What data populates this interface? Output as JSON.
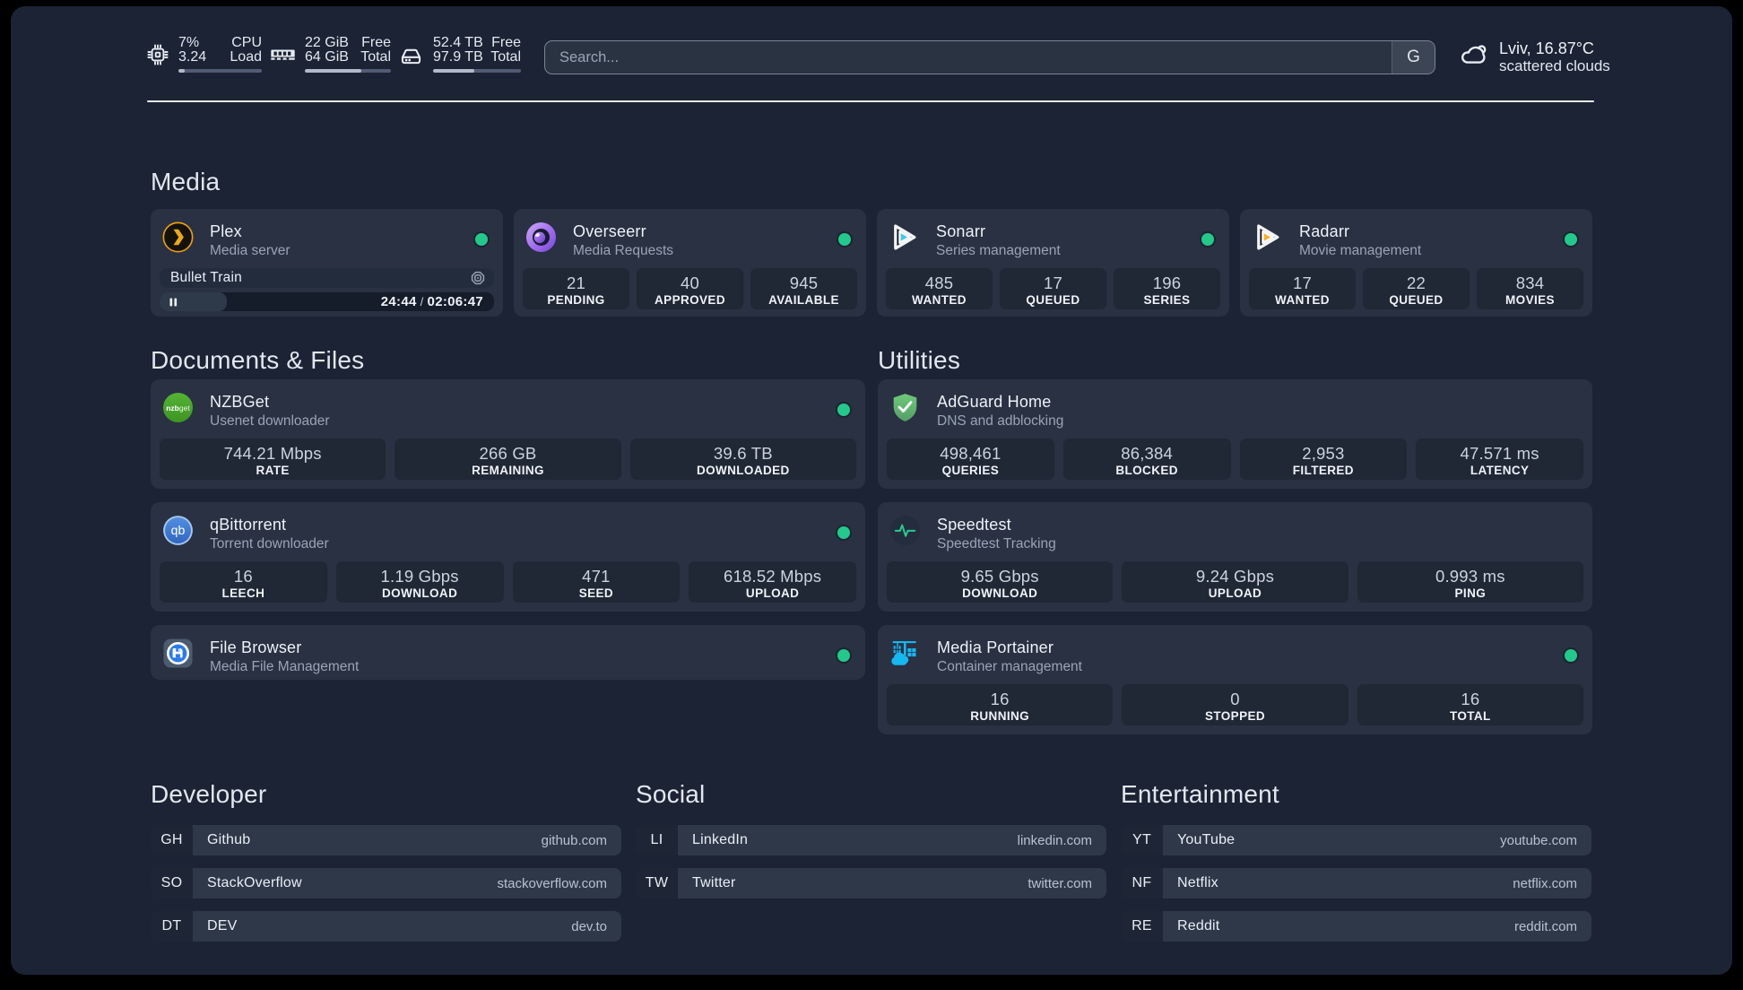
{
  "window": {
    "background": "#000000",
    "page_background": "#1b2334"
  },
  "theme": {
    "card": "#293142",
    "stat_box": "#202836",
    "status_online": "#22c98b",
    "divider": "#e8ebf0",
    "accent_plex": "#e5a00d",
    "accent_sonarr": "#38c6f4",
    "accent_radarr": "#fcb022",
    "accent_overseerr": "#9261e7",
    "accent_nzbget": "#4aa52e",
    "accent_qbittorrent": "#4a84d4",
    "accent_adguard": "#63b973",
    "accent_speedtest": "#27c98f",
    "accent_portainer": "#16b8f2",
    "accent_filebrowser": "#2b7cea"
  },
  "topbar": {
    "resources": [
      {
        "id": "cpu",
        "icon": "cpu-icon",
        "line1_left": "7%",
        "line1_right": "CPU",
        "line2_left": "3.24",
        "line2_right": "Load",
        "bar_width": "8%"
      },
      {
        "id": "memory",
        "icon": "memory-icon",
        "line1_left": "22 GiB",
        "line1_right": "Free",
        "line2_left": "64 GiB",
        "line2_right": "Total",
        "bar_width": "65.6%"
      },
      {
        "id": "disk",
        "icon": "disk-icon",
        "line1_left": "52.4 TB",
        "line1_right": "Free",
        "line2_left": "97.9 TB",
        "line2_right": "Total",
        "bar_width": "46.5%"
      }
    ],
    "search": {
      "placeholder": "Search...",
      "button_label": "G"
    },
    "weather": {
      "icon": "cloud-icon",
      "location_temp": "Lviv, 16.87°C",
      "condition": "scattered clouds"
    }
  },
  "groups": [
    {
      "title": "Media",
      "services": [
        {
          "id": "plex",
          "name": "Plex",
          "description": "Media server",
          "icon": "plex-icon",
          "status": "online",
          "now_playing": {
            "title": "Bullet Train",
            "icon": "camera-iris-icon",
            "elapsed": "24:44",
            "separator": "/",
            "total": "02:06:47",
            "progress_width": "20%"
          }
        },
        {
          "id": "overseerr",
          "name": "Overseerr",
          "description": "Media Requests",
          "icon": "overseerr-icon",
          "status": "online",
          "stats": [
            {
              "value": "21",
              "label": "PENDING"
            },
            {
              "value": "40",
              "label": "APPROVED"
            },
            {
              "value": "945",
              "label": "AVAILABLE"
            }
          ]
        },
        {
          "id": "sonarr",
          "name": "Sonarr",
          "description": "Series management",
          "icon": "sonarr-icon",
          "status": "online",
          "stats": [
            {
              "value": "485",
              "label": "WANTED"
            },
            {
              "value": "17",
              "label": "QUEUED"
            },
            {
              "value": "196",
              "label": "SERIES"
            }
          ]
        },
        {
          "id": "radarr",
          "name": "Radarr",
          "description": "Movie management",
          "icon": "radarr-icon",
          "status": "online",
          "stats": [
            {
              "value": "17",
              "label": "WANTED"
            },
            {
              "value": "22",
              "label": "QUEUED"
            },
            {
              "value": "834",
              "label": "MOVIES"
            }
          ]
        }
      ]
    },
    {
      "title": "Documents & Files",
      "services": [
        {
          "id": "nzbget",
          "name": "NZBGet",
          "description": "Usenet downloader",
          "icon": "nzbget-icon",
          "status": "online",
          "stats": [
            {
              "value": "744.21 Mbps",
              "label": "RATE"
            },
            {
              "value": "266 GB",
              "label": "REMAINING"
            },
            {
              "value": "39.6 TB",
              "label": "DOWNLOADED"
            }
          ]
        },
        {
          "id": "qbittorrent",
          "name": "qBittorrent",
          "description": "Torrent downloader",
          "icon": "qbittorrent-icon",
          "status": "online",
          "stats": [
            {
              "value": "16",
              "label": "LEECH"
            },
            {
              "value": "1.19 Gbps",
              "label": "DOWNLOAD"
            },
            {
              "value": "471",
              "label": "SEED"
            },
            {
              "value": "618.52 Mbps",
              "label": "UPLOAD"
            }
          ]
        },
        {
          "id": "filebrowser",
          "name": "File Browser",
          "description": "Media File Management",
          "icon": "filebrowser-icon",
          "status": "online",
          "stats": []
        }
      ]
    },
    {
      "title": "Utilities",
      "services": [
        {
          "id": "adguard",
          "name": "AdGuard Home",
          "description": "DNS and adblocking",
          "icon": "adguard-icon",
          "status": "none",
          "stats": [
            {
              "value": "498,461",
              "label": "QUERIES"
            },
            {
              "value": "86,384",
              "label": "BLOCKED"
            },
            {
              "value": "2,953",
              "label": "FILTERED"
            },
            {
              "value": "47.571 ms",
              "label": "LATENCY"
            }
          ]
        },
        {
          "id": "speedtest",
          "name": "Speedtest",
          "description": "Speedtest Tracking",
          "icon": "speedtest-icon",
          "status": "none",
          "stats": [
            {
              "value": "9.65 Gbps",
              "label": "DOWNLOAD"
            },
            {
              "value": "9.24 Gbps",
              "label": "UPLOAD"
            },
            {
              "value": "0.993 ms",
              "label": "PING"
            }
          ]
        },
        {
          "id": "portainer",
          "name": "Media Portainer",
          "description": "Container management",
          "icon": "portainer-icon",
          "status": "online",
          "stats": [
            {
              "value": "16",
              "label": "RUNNING"
            },
            {
              "value": "0",
              "label": "STOPPED"
            },
            {
              "value": "16",
              "label": "TOTAL"
            }
          ]
        }
      ]
    }
  ],
  "bookmark_groups": [
    {
      "title": "Developer",
      "bookmarks": [
        {
          "abbr": "GH",
          "name": "Github",
          "domain": "github.com"
        },
        {
          "abbr": "SO",
          "name": "StackOverflow",
          "domain": "stackoverflow.com"
        },
        {
          "abbr": "DT",
          "name": "DEV",
          "domain": "dev.to"
        }
      ]
    },
    {
      "title": "Social",
      "bookmarks": [
        {
          "abbr": "LI",
          "name": "LinkedIn",
          "domain": "linkedin.com"
        },
        {
          "abbr": "TW",
          "name": "Twitter",
          "domain": "twitter.com"
        }
      ]
    },
    {
      "title": "Entertainment",
      "bookmarks": [
        {
          "abbr": "YT",
          "name": "YouTube",
          "domain": "youtube.com"
        },
        {
          "abbr": "NF",
          "name": "Netflix",
          "domain": "netflix.com"
        },
        {
          "abbr": "RE",
          "name": "Reddit",
          "domain": "reddit.com"
        }
      ]
    }
  ],
  "logo_text": {
    "nzbget_bold": "nzb",
    "nzbget_rest": "get",
    "qbittorrent": "qb"
  }
}
